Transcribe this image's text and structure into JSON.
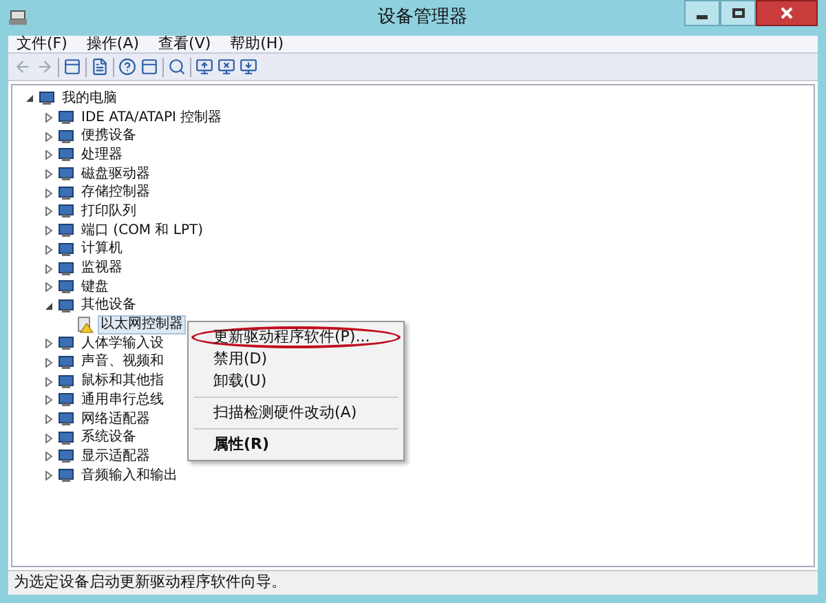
{
  "window": {
    "title": "设备管理器"
  },
  "menu_bar": [
    "文件(F)",
    "操作(A)",
    "查看(V)",
    "帮助(H)"
  ],
  "tree": [
    {
      "label": "我的电脑",
      "expanded": true,
      "selected": false,
      "children": [
        {
          "label": "IDE ATA/ATAPI 控制器",
          "expanded": false,
          "selected": false
        },
        {
          "label": "便携设备",
          "expanded": false,
          "selected": false
        },
        {
          "label": "处理器",
          "expanded": false,
          "selected": false
        },
        {
          "label": "磁盘驱动器",
          "expanded": false,
          "selected": false
        },
        {
          "label": "存储控制器",
          "expanded": false,
          "selected": false
        },
        {
          "label": "打印队列",
          "expanded": false,
          "selected": false
        },
        {
          "label": "端口 (COM 和 LPT)",
          "expanded": false,
          "selected": false
        },
        {
          "label": "计算机",
          "expanded": false,
          "selected": false
        },
        {
          "label": "监视器",
          "expanded": false,
          "selected": false
        },
        {
          "label": "键盘",
          "expanded": false,
          "selected": false
        },
        {
          "label": "其他设备",
          "expanded": true,
          "selected": false,
          "children": [
            {
              "label": "以太网控制器",
              "selected": true,
              "warning": true
            }
          ]
        },
        {
          "label": "人体学输入设",
          "expanded": false,
          "selected": false
        },
        {
          "label": "声音、视频和",
          "expanded": false,
          "selected": false
        },
        {
          "label": "鼠标和其他指",
          "expanded": false,
          "selected": false
        },
        {
          "label": "通用串行总线",
          "expanded": false,
          "selected": false
        },
        {
          "label": "网络适配器",
          "expanded": false,
          "selected": false
        },
        {
          "label": "系统设备",
          "expanded": false,
          "selected": false
        },
        {
          "label": "显示适配器",
          "expanded": false,
          "selected": false
        },
        {
          "label": "音频输入和输出",
          "expanded": false,
          "selected": false
        }
      ]
    }
  ],
  "context_menu": [
    {
      "label": "更新驱动程序软件(P)...",
      "circled": true,
      "separator_before": false,
      "default": false
    },
    {
      "label": "禁用(D)",
      "circled": false,
      "separator_before": false,
      "default": false
    },
    {
      "label": "卸载(U)",
      "circled": false,
      "separator_before": false,
      "default": false
    },
    {
      "label": "扫描检测硬件改动(A)",
      "circled": false,
      "separator_before": true,
      "default": false
    },
    {
      "label": "属性(R)",
      "circled": false,
      "separator_before": true,
      "default": true
    }
  ],
  "status_bar": "为选定设备启动更新驱动程序软件向导。"
}
